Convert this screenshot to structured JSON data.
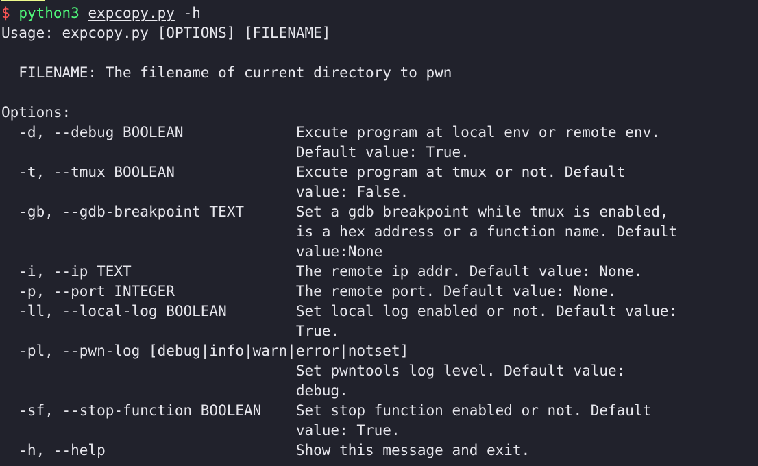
{
  "terminal": {
    "background_color": "#21222c",
    "foreground_color": "#e6e6ec",
    "prompt_color": "#ff5555",
    "command_color": "#50fa7b",
    "highlight_color": "#eefa8c",
    "scrollback_fragment": "     ",
    "prompt_symbol": "$",
    "command": "python3",
    "command_argument": "expcopy.py",
    "command_flag": "-h",
    "usage_line": "Usage: expcopy.py [OPTIONS] [FILENAME]",
    "blank_line": "",
    "filename_help": "  FILENAME: The filename of current directory to pwn",
    "options_heading": "Options:",
    "description_column": 34,
    "options": [
      {
        "flags": "  -d, --debug BOOLEAN",
        "description_lines": [
          "Excute program at local env or remote env.",
          "Default value: True."
        ]
      },
      {
        "flags": "  -t, --tmux BOOLEAN",
        "description_lines": [
          "Excute program at tmux or not. Default",
          "value: False."
        ]
      },
      {
        "flags": "  -gb, --gdb-breakpoint TEXT",
        "description_lines": [
          "Set a gdb breakpoint while tmux is enabled,",
          "is a hex address or a function name. Default",
          "value:None"
        ]
      },
      {
        "flags": "  -i, --ip TEXT",
        "description_lines": [
          "The remote ip addr. Default value: None."
        ]
      },
      {
        "flags": "  -p, --port INTEGER",
        "description_lines": [
          "The remote port. Default value: None."
        ]
      },
      {
        "flags": "  -ll, --local-log BOOLEAN",
        "description_lines": [
          "Set local log enabled or not. Default value:",
          "True."
        ]
      },
      {
        "flags": "  -pl, --pwn-log [debug|info|warn|error|notset]",
        "description_lines": [
          "Set pwntools log level. Default value:",
          "debug."
        ]
      },
      {
        "flags": "  -sf, --stop-function BOOLEAN",
        "description_lines": [
          "Set stop function enabled or not. Default",
          "value: True."
        ]
      },
      {
        "flags": "  -h, --help",
        "description_lines": [
          "Show this message and exit."
        ]
      }
    ]
  }
}
